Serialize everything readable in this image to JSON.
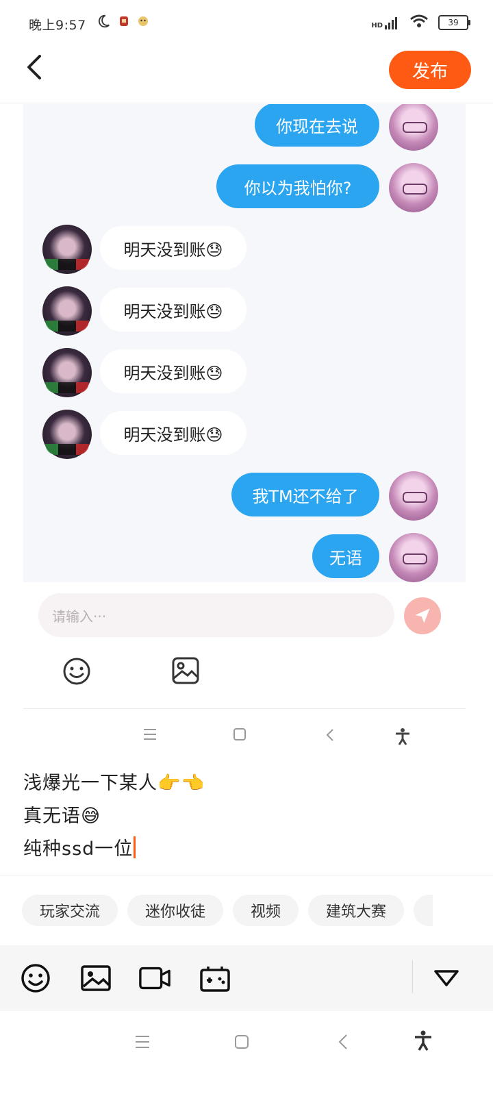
{
  "status_bar": {
    "time": "晚上9:57",
    "icons_left": [
      "moon-icon",
      "app-icon-1",
      "app-icon-2"
    ],
    "network": "HD",
    "battery": "39"
  },
  "header": {
    "back_icon": "chevron-left-icon",
    "publish_label": "发布"
  },
  "chat": {
    "messages": [
      {
        "side": "out",
        "text": "你现在去说"
      },
      {
        "side": "out",
        "text": "你以为我怕你?"
      },
      {
        "side": "in",
        "text": "明天没到账😓"
      },
      {
        "side": "in",
        "text": "明天没到账😓"
      },
      {
        "side": "in",
        "text": "明天没到账😓"
      },
      {
        "side": "in",
        "text": "明天没到账😓"
      },
      {
        "side": "out",
        "text": "我TM还不给了"
      },
      {
        "side": "out",
        "text": "无语"
      }
    ],
    "input_placeholder": "请输入···",
    "send_icon": "send-icon",
    "tools": [
      "emoji-icon",
      "image-icon"
    ],
    "nav": [
      "menu-icon",
      "home-icon",
      "back-icon",
      "accessibility-icon"
    ]
  },
  "post": {
    "lines": [
      "浅爆光一下某人👉👈",
      "真无语😅",
      "纯种ssd一位"
    ]
  },
  "tags": [
    "玩家交流",
    "迷你收徒",
    "视频",
    "建筑大赛"
  ],
  "toolbar": {
    "icons": [
      "emoji-icon",
      "image-icon",
      "video-icon",
      "gamepad-icon"
    ],
    "collapse_icon": "triangle-down-icon"
  },
  "system_nav": [
    "menu-icon",
    "home-icon",
    "back-icon",
    "accessibility-icon"
  ],
  "colors": {
    "accent": "#ff5a14",
    "bubble_out": "#2ba5f0",
    "cursor": "#ff5a14"
  }
}
